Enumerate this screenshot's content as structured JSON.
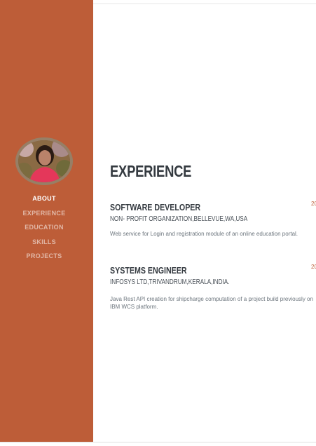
{
  "sidebar": {
    "nav": [
      {
        "label": "ABOUT",
        "active": true
      },
      {
        "label": "EXPERIENCE",
        "active": false
      },
      {
        "label": "EDUCATION",
        "active": false
      },
      {
        "label": "SKILLS",
        "active": false
      },
      {
        "label": "PROJECTS",
        "active": false
      }
    ]
  },
  "experience": {
    "title": "EXPERIENCE",
    "jobs": [
      {
        "title": "SOFTWARE DEVELOPER",
        "org": "NON- PROFIT ORGANIZATION,BELLEVUE,WA,USA",
        "description": "Web service for Login and registration module of an online education portal.",
        "date": "20"
      },
      {
        "title": "SYSTEMS ENGINEER",
        "org": "INFOSYS LTD,TRIVANDRUM,KERALA,INDIA.",
        "description": "Java Rest API creation for shipcharge computation of a project build previously on IBM WCS platform.",
        "date": "20"
      }
    ]
  },
  "colors": {
    "sidebar": "#bd5d38",
    "heading": "#343a40",
    "accent": "#bd5d38"
  }
}
